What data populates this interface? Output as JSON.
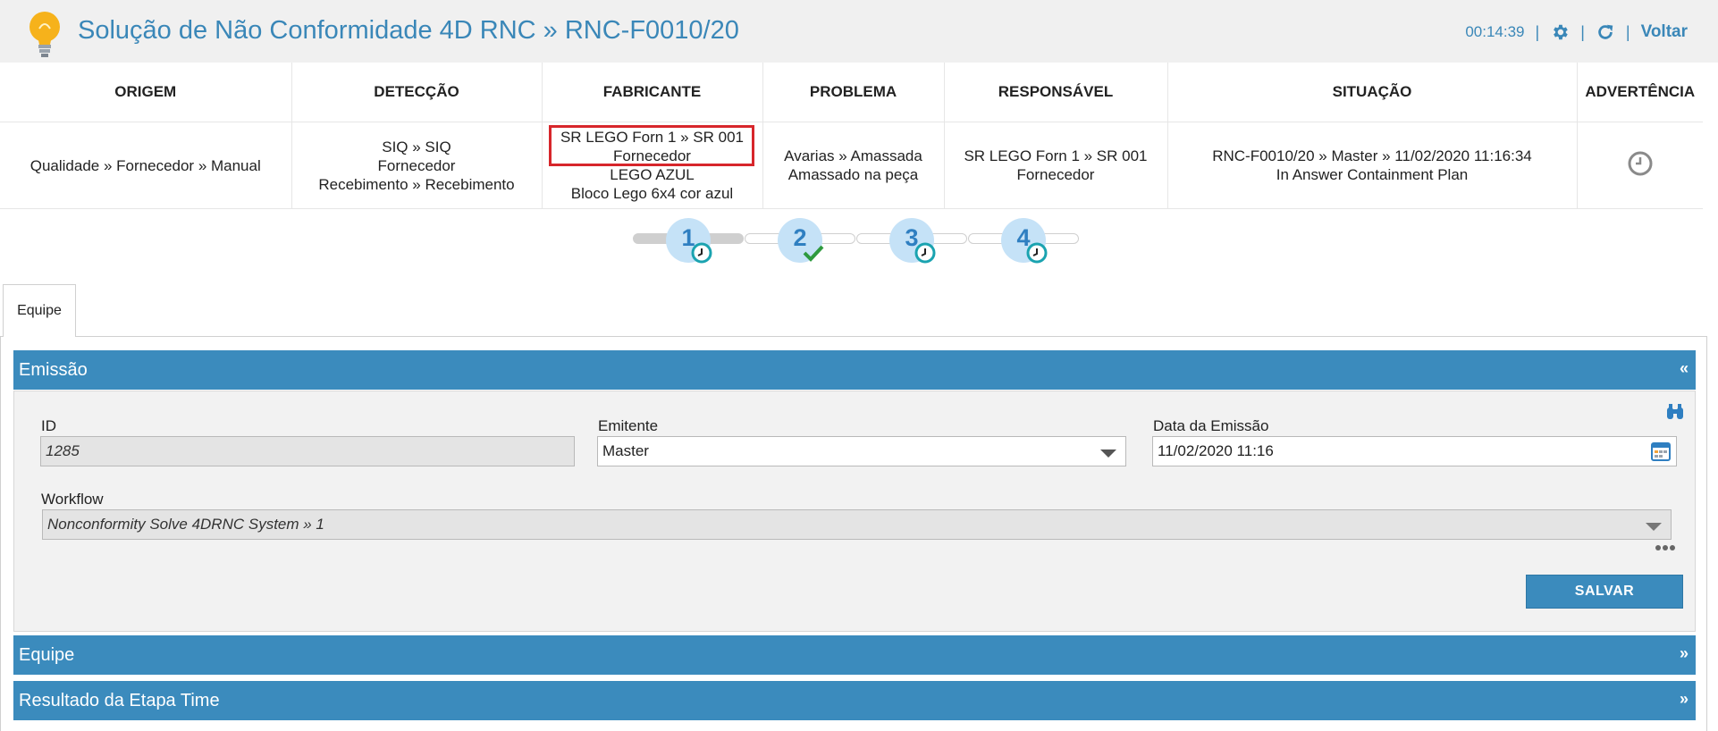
{
  "header": {
    "title": "Solução de Não Conformidade 4D RNC » RNC-F0010/20",
    "timer": "00:14:39",
    "separator": "|",
    "back_label": "Voltar"
  },
  "summary": {
    "columns": [
      "ORIGEM",
      "DETECÇÃO",
      "FABRICANTE",
      "PROBLEMA",
      "RESPONSÁVEL",
      "SITUAÇÃO",
      "ADVERTÊNCIA"
    ],
    "origem": [
      "Qualidade » Fornecedor » Manual"
    ],
    "deteccao": [
      "SIQ » SIQ",
      "Fornecedor",
      "Recebimento » Recebimento"
    ],
    "fabricante": [
      "SR LEGO Forn 1 » SR 001",
      "Fornecedor",
      "LEGO AZUL",
      "Bloco Lego 6x4 cor azul"
    ],
    "problema": [
      "Avarias » Amassada",
      "Amassado na peça"
    ],
    "responsavel": [
      "SR LEGO Forn 1 » SR 001",
      "Fornecedor"
    ],
    "situacao": [
      "RNC-F0010/20 » Master » 11/02/2020 11:16:34",
      "In Answer Containment Plan"
    ],
    "advertencia_icon": "clock-icon"
  },
  "stepper": {
    "steps": [
      {
        "number": "1",
        "status": "clock-icon"
      },
      {
        "number": "2",
        "status": "check-icon"
      },
      {
        "number": "3",
        "status": "clock-icon"
      },
      {
        "number": "4",
        "status": "clock-icon"
      }
    ]
  },
  "tabs": [
    {
      "label": "Equipe"
    }
  ],
  "sections": {
    "emissao": {
      "title": "Emissão",
      "toggle": "«"
    },
    "equipe": {
      "title": "Equipe",
      "toggle": "»"
    },
    "resultado": {
      "title": "Resultado da Etapa Time",
      "toggle": "»"
    }
  },
  "form": {
    "id": {
      "label": "ID",
      "value": "1285"
    },
    "emitente": {
      "label": "Emitente",
      "value": "Master"
    },
    "data_emissao": {
      "label": "Data da Emissão",
      "value": "11/02/2020 11:16"
    },
    "workflow": {
      "label": "Workflow",
      "value": "Nonconformity Solve 4DRNC System » 1"
    },
    "save_label": "SALVAR"
  },
  "colors": {
    "accent": "#3b8bbd",
    "title": "#3a87b8",
    "highlight": "#d7262b",
    "step_circle": "#c5e2f7",
    "check": "#2e9a3e"
  }
}
